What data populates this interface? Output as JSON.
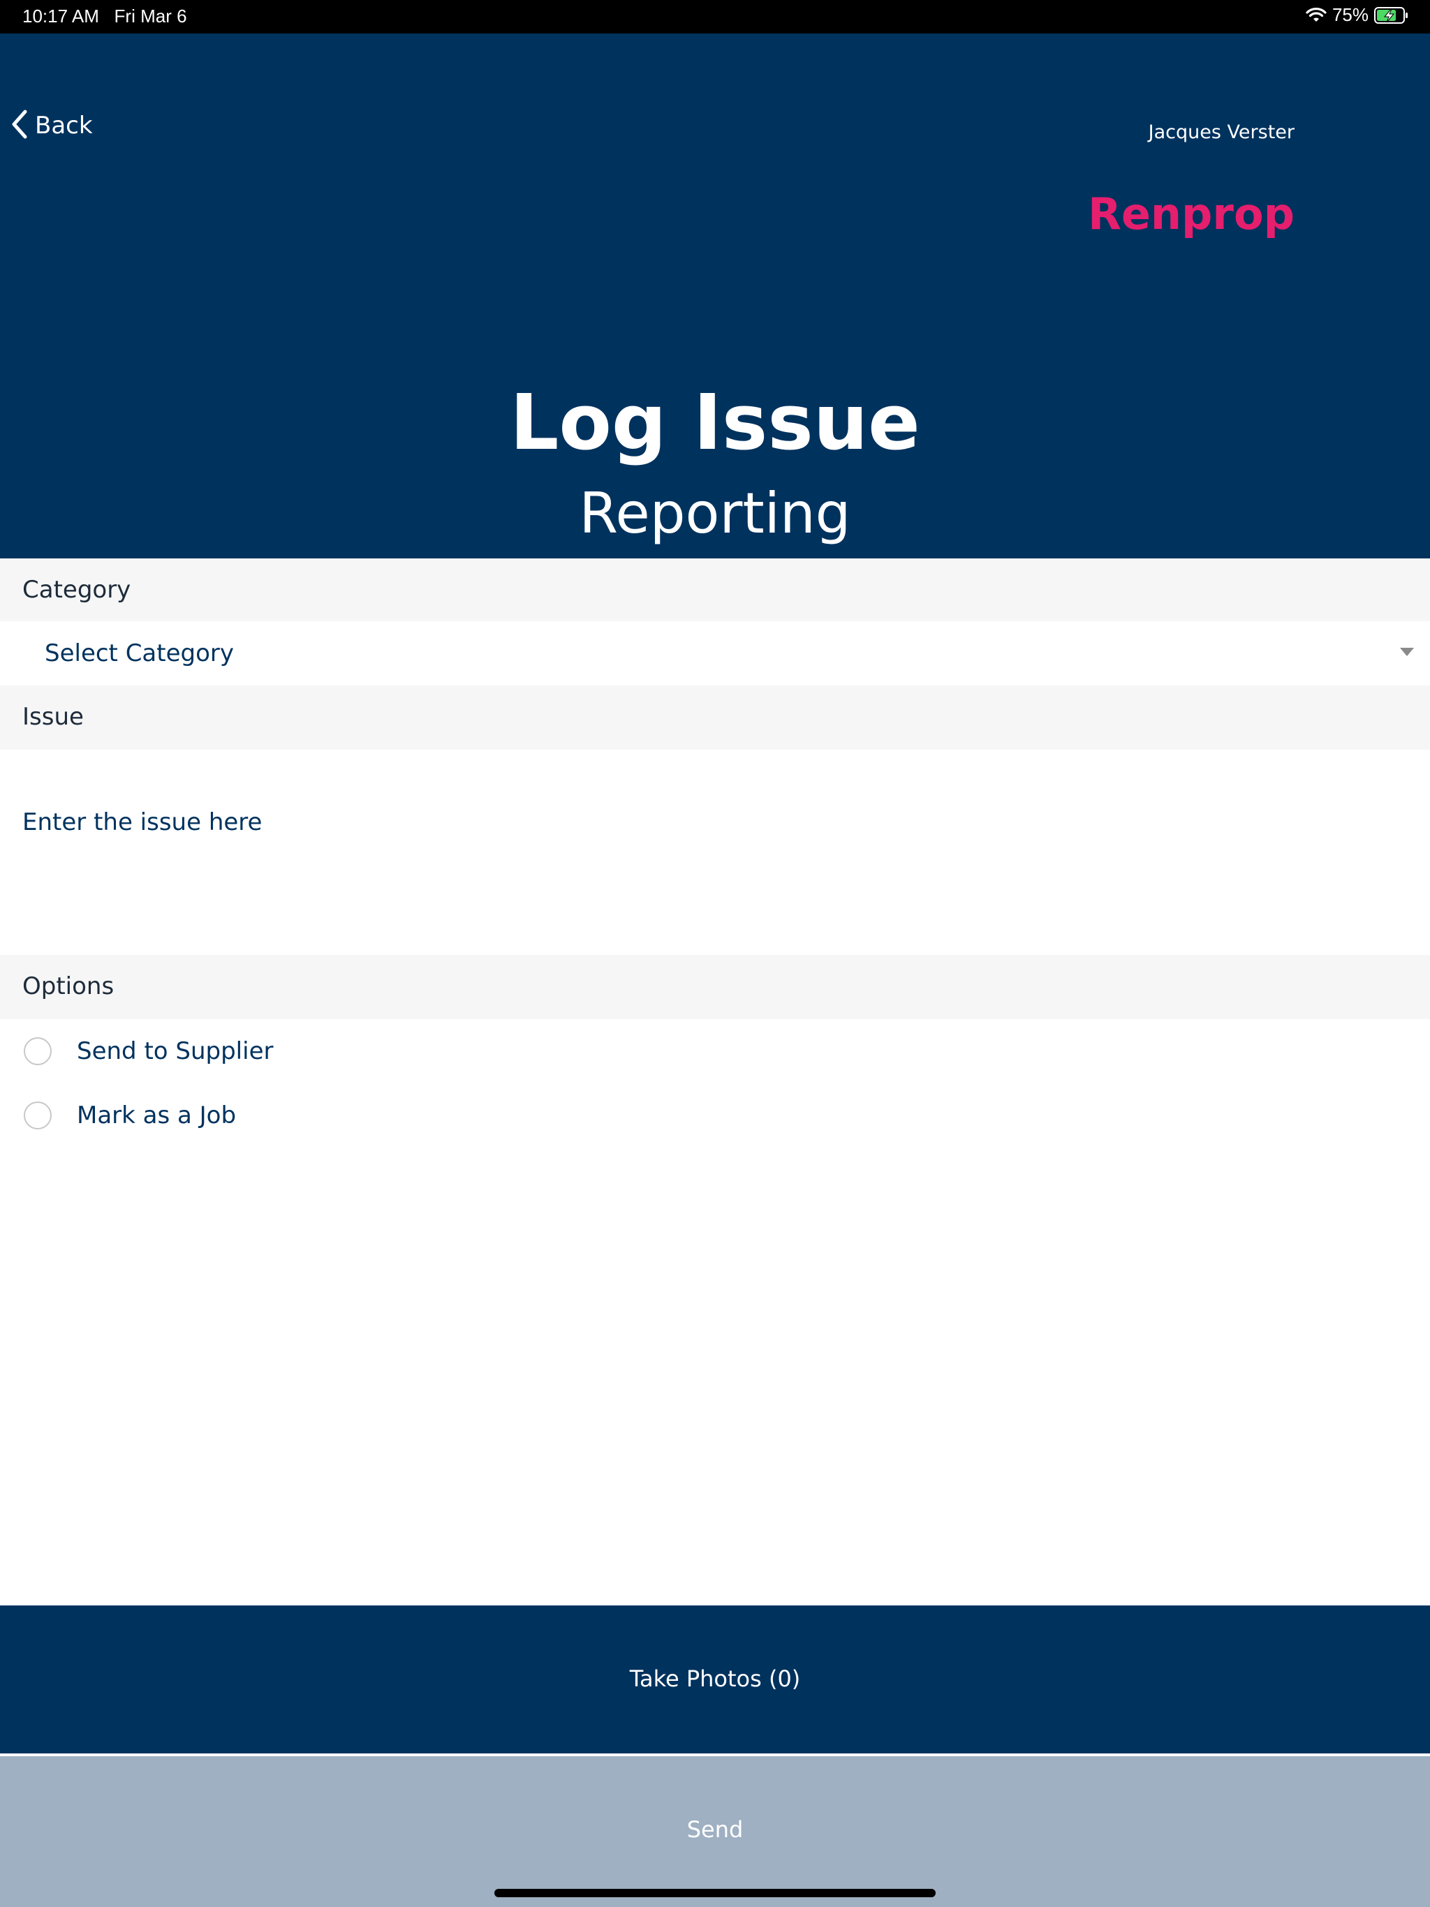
{
  "status_bar": {
    "time": "10:17 AM",
    "date": "Fri Mar 6",
    "battery": "75%",
    "battery_level": 0.75,
    "icons": [
      "wifi-icon",
      "battery-charging-icon"
    ]
  },
  "header": {
    "back_label": "Back",
    "user_name": "Jacques Verster",
    "brand": "Renprop",
    "title": "Log Issue",
    "subtitle": "Reporting"
  },
  "colors": {
    "header_bg": "#00325e",
    "brand_pink": "#e61e6e",
    "section_bg": "#f6f6f6",
    "send_bg": "#9eb0c2"
  },
  "form": {
    "category_label": "Category",
    "category_value": "Select Category",
    "issue_label": "Issue",
    "issue_placeholder": "Enter the issue here",
    "options_label": "Options",
    "options": [
      {
        "label": "Send to Supplier",
        "checked": false
      },
      {
        "label": "Mark as a Job",
        "checked": false
      }
    ]
  },
  "actions": {
    "photos_label": "Take Photos (0)",
    "send_label": "Send"
  }
}
